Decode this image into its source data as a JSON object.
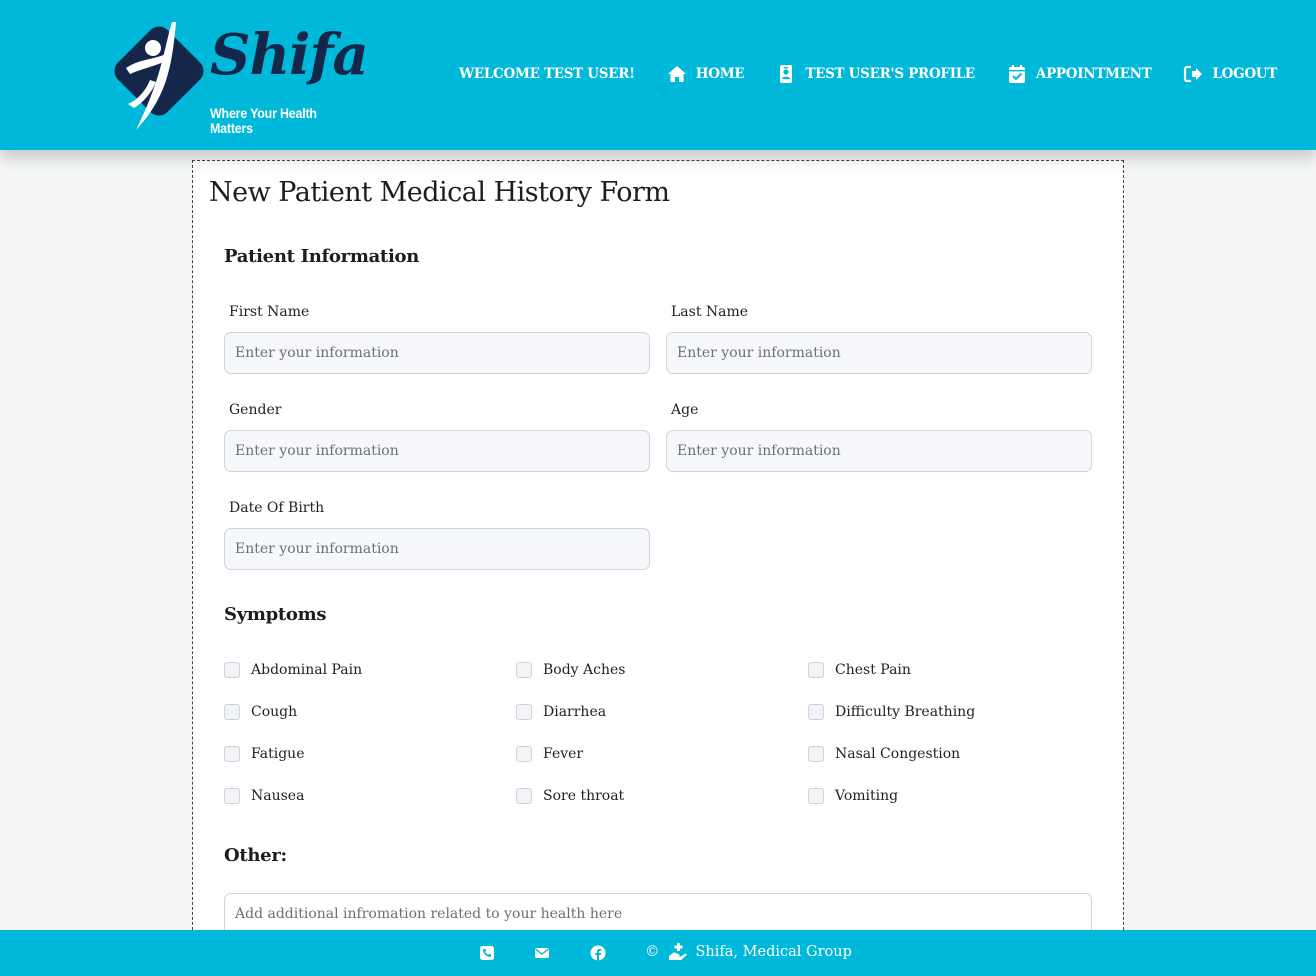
{
  "brand": {
    "name": "Shifa",
    "tagline": "Where Your Health Matters"
  },
  "nav": {
    "welcome": "WELCOME TEST USER!",
    "home": "HOME",
    "profile": "TEST USER'S PROFILE",
    "appointment": "APPOINTMENT",
    "logout": "LOGOUT"
  },
  "form": {
    "title": "New Patient Medical History Form",
    "patient_section": "Patient Information",
    "placeholder": "Enter your information",
    "fields": {
      "first_name": "First Name",
      "last_name": "Last Name",
      "gender": "Gender",
      "age": "Age",
      "dob": "Date Of Birth"
    },
    "symptoms_section": "Symptoms",
    "symptoms": [
      "Abdominal Pain",
      "Body Aches",
      "Chest Pain",
      "Cough",
      "Diarrhea",
      "Difficulty Breathing",
      "Fatigue",
      "Fever",
      "Nasal Congestion",
      "Nausea",
      "Sore throat",
      "Vomiting"
    ],
    "other_section": "Other:",
    "other_placeholder": "Add additional infromation related to your health here"
  },
  "footer": {
    "copyright_symbol": "©",
    "org": "Shifa, Medical Group"
  },
  "colors": {
    "header_bg": "#00b8d9",
    "logo_navy": "#14274a",
    "page_bg": "#f3f6f4"
  },
  "icons": {
    "home": "home-icon",
    "profile": "id-badge-icon",
    "appointment": "calendar-check-icon",
    "logout": "sign-out-icon",
    "phone": "phone-icon",
    "mail": "envelope-icon",
    "facebook": "facebook-icon",
    "hand": "hand-holding-medical-icon"
  }
}
